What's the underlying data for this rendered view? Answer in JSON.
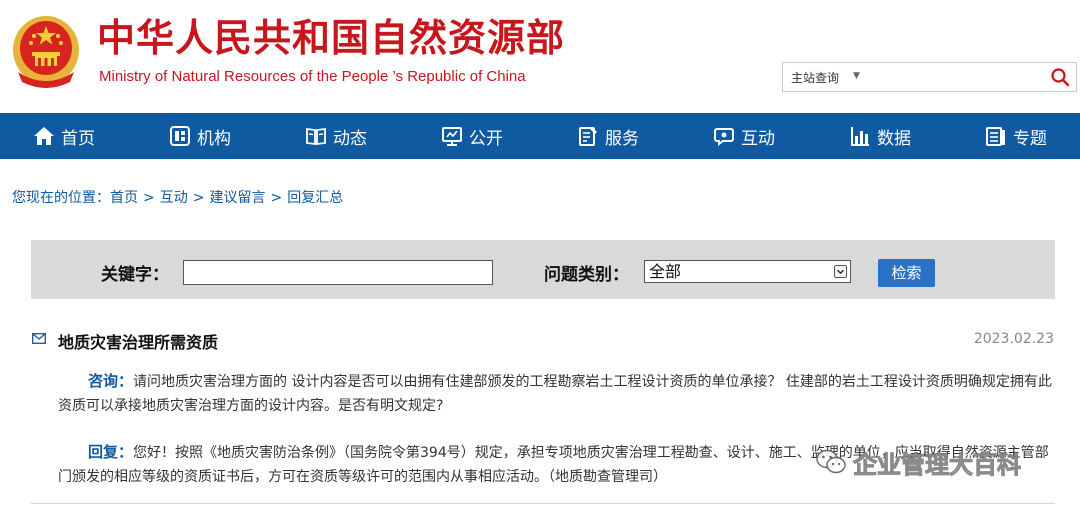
{
  "header": {
    "title": "中华人民共和国自然资源部",
    "subtitle": "Ministry of Natural Resources of the People ’s Republic of China",
    "search": {
      "scope": "主站查询"
    }
  },
  "nav": {
    "items": [
      {
        "label": "首页",
        "icon": "home-icon"
      },
      {
        "label": "机构",
        "icon": "org-icon"
      },
      {
        "label": "动态",
        "icon": "news-icon"
      },
      {
        "label": "公开",
        "icon": "public-icon"
      },
      {
        "label": "服务",
        "icon": "service-icon"
      },
      {
        "label": "互动",
        "icon": "chat-icon"
      },
      {
        "label": "数据",
        "icon": "chart-icon"
      },
      {
        "label": "专题",
        "icon": "topic-icon"
      }
    ]
  },
  "breadcrumb": {
    "prefix": "您现在的位置：",
    "items": [
      "首页",
      "互动",
      "建议留言",
      "回复汇总"
    ]
  },
  "filter": {
    "keyword_label": "关键字：",
    "keyword_value": "",
    "type_label": "问题类别：",
    "type_selected": "全部",
    "search_button": "检索"
  },
  "entry": {
    "title": "地质灾害治理所需资质",
    "date": "2023.02.23",
    "ask_label": "咨询：",
    "ask_text": "请问地质灾害治理方面的 设计内容是否可以由拥有住建部颁发的工程勘察岩土工程设计资质的单位承接？ 住建部的岩土工程设计资质明确规定拥有此资质可以承接地质灾害治理方面的设计内容。是否有明文规定?",
    "reply_label": "回复：",
    "reply_text": "您好！按照《地质灾害防治条例》（国务院令第394号）规定，承担专项地质灾害治理工程勘查、设计、施工、监理的单位，应当取得自然资源主管部门颁发的相应等级的资质证书后，方可在资质等级许可的范围内从事相应活动。（地质勘查管理司）"
  },
  "watermark": {
    "text": "企业管理大百科"
  },
  "colors": {
    "brand_red": "#c8161d",
    "nav_blue": "#0f5aa0",
    "button_blue": "#2a72c8",
    "filter_gray": "#d9d9d9"
  }
}
